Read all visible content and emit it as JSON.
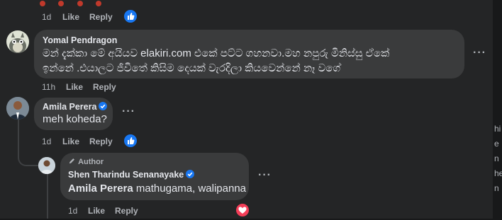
{
  "top_comment": {
    "time": "1d",
    "like_label": "Like",
    "reply_label": "Reply",
    "reaction": "like-icon"
  },
  "comment_yomal": {
    "author": "Yomal Pendragon",
    "text_line1": "මන් දැක්කා මේ අයියව elakiri.com එකේ පට්ට ගහනවා.මහ නපුරු මිනිස්සු ඒකේ",
    "text_line2": "ඉන්නේ .එයාලට ජීවිතේ කිසිම දෙයක් වැරදිලා කියවෙන්නේ නෑ වගේ",
    "time": "11h",
    "like_label": "Like",
    "reply_label": "Reply",
    "more_label": "···"
  },
  "comment_amila": {
    "author": "Amila Perera",
    "text": "meh koheda?",
    "time": "1d",
    "like_label": "Like",
    "reply_label": "Reply",
    "more_label": "···",
    "reaction": "like-icon"
  },
  "comment_shen": {
    "badge": "Author",
    "author": "Shen Tharindu Senanayake",
    "mention": "Amila Perera",
    "text": " mathugama, walipanna",
    "time": "1d",
    "like_label": "Like",
    "reply_label": "Reply",
    "more_label": "···",
    "reaction": "love-icon"
  },
  "side_strip": [
    "hi",
    "e",
    "n",
    "he",
    "n"
  ],
  "colors": {
    "background": "#242526",
    "bubble": "#3a3b3c",
    "text": "#e4e6eb",
    "secondary_text": "#b0b3b8",
    "like_blue": "#1877f2",
    "love_red": "#f33e58"
  }
}
